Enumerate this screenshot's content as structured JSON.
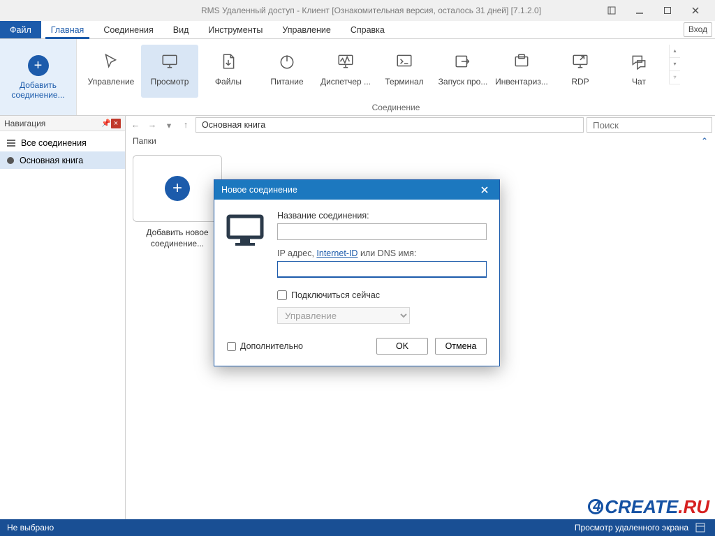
{
  "window": {
    "title": "RMS Удаленный доступ - Клиент [Ознакомительная версия, осталось 31 дней] [7.1.2.0]"
  },
  "menubar": {
    "file": "Файл",
    "tabs": [
      "Главная",
      "Соединения",
      "Вид",
      "Инструменты",
      "Управление",
      "Справка"
    ],
    "login": "Вход"
  },
  "ribbon": {
    "add": {
      "line1": "Добавить",
      "line2": "соединение..."
    },
    "buttons": [
      {
        "id": "control",
        "label": "Управление",
        "icon": "cursor-icon"
      },
      {
        "id": "view",
        "label": "Просмотр",
        "icon": "monitor-icon",
        "active": true
      },
      {
        "id": "files",
        "label": "Файлы",
        "icon": "file-arrow-icon"
      },
      {
        "id": "power",
        "label": "Питание",
        "icon": "power-icon"
      },
      {
        "id": "dispatch",
        "label": "Диспетчер ...",
        "icon": "activity-icon"
      },
      {
        "id": "terminal",
        "label": "Терминал",
        "icon": "terminal-icon"
      },
      {
        "id": "launch",
        "label": "Запуск про...",
        "icon": "launch-icon"
      },
      {
        "id": "inventory",
        "label": "Инвентариз...",
        "icon": "inventory-icon"
      },
      {
        "id": "rdp",
        "label": "RDP",
        "icon": "rdp-icon"
      },
      {
        "id": "chat",
        "label": "Чат",
        "icon": "chat-icon"
      }
    ],
    "group_label": "Соединение"
  },
  "sidebar": {
    "title": "Навигация",
    "items": [
      {
        "label": "Все соединения",
        "icon": "list"
      },
      {
        "label": "Основная книга",
        "icon": "dot",
        "selected": true
      }
    ]
  },
  "nav": {
    "breadcrumb": "Основная книга",
    "search_placeholder": "Поиск"
  },
  "folders": {
    "header": "Папки"
  },
  "tile": {
    "line1": "Добавить новое",
    "line2": "соединение..."
  },
  "dialog": {
    "title": "Новое соединение",
    "name_label": "Название соединения:",
    "name_value": "",
    "addr_label_pre": "IP адрес, ",
    "addr_label_link": "Internet-ID",
    "addr_label_post": " или DNS имя:",
    "addr_value": "",
    "connect_now": "Подключиться сейчас",
    "mode_value": "Управление",
    "advanced": "Дополнительно",
    "ok": "OK",
    "cancel": "Отмена"
  },
  "status": {
    "left": "Не выбрано",
    "right": "Просмотр удаленного экрана"
  },
  "watermark": {
    "brand": "CREATE",
    "suffix": ".RU"
  },
  "colors": {
    "accent": "#1c5bab",
    "titlebar_bg": "#f0f0f0",
    "modal_title": "#1c78bf",
    "status_bg": "#194f94"
  }
}
